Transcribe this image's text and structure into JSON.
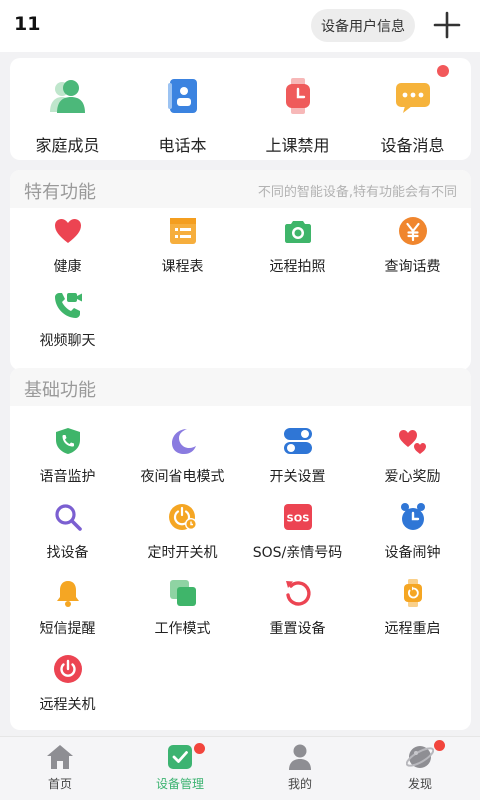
{
  "header": {
    "device_name": "11",
    "user_info_button": "设备用户信息",
    "add_icon": "plus-icon"
  },
  "quick_actions": [
    {
      "label": "家庭成员",
      "icon": "family-members-icon",
      "color": "#4cb87a"
    },
    {
      "label": "电话本",
      "icon": "phonebook-icon",
      "color": "#3b83e0"
    },
    {
      "label": "上课禁用",
      "icon": "class-disable-watch-icon",
      "color": "#ef5b5b"
    },
    {
      "label": "设备消息",
      "icon": "device-message-icon",
      "color": "#f6b33b",
      "has_badge": true
    }
  ],
  "special_section": {
    "title": "特有功能",
    "hint": "不同的智能设备,特有功能会有不同",
    "items": [
      {
        "label": "健康",
        "icon": "heart-icon"
      },
      {
        "label": "课程表",
        "icon": "schedule-icon"
      },
      {
        "label": "远程拍照",
        "icon": "camera-icon"
      },
      {
        "label": "查询话费",
        "icon": "yuan-coin-icon"
      },
      {
        "label": "视频聊天",
        "icon": "video-call-icon"
      }
    ]
  },
  "basic_section": {
    "title": "基础功能",
    "items": [
      {
        "label": "语音监护",
        "icon": "voice-monitor-icon"
      },
      {
        "label": "夜间省电模式",
        "icon": "moon-icon"
      },
      {
        "label": "开关设置",
        "icon": "toggle-icon"
      },
      {
        "label": "爱心奖励",
        "icon": "hearts-icon"
      },
      {
        "label": "找设备",
        "icon": "search-icon"
      },
      {
        "label": "定时开关机",
        "icon": "timed-power-icon"
      },
      {
        "label": "SOS/亲情号码",
        "icon": "sos-icon"
      },
      {
        "label": "设备闹钟",
        "icon": "alarm-clock-icon"
      },
      {
        "label": "短信提醒",
        "icon": "bell-icon"
      },
      {
        "label": "工作模式",
        "icon": "work-mode-icon"
      },
      {
        "label": "重置设备",
        "icon": "reset-icon"
      },
      {
        "label": "远程重启",
        "icon": "remote-restart-icon"
      },
      {
        "label": "远程关机",
        "icon": "power-off-icon"
      }
    ]
  },
  "tabbar": {
    "items": [
      {
        "label": "首页",
        "icon": "home-icon",
        "active": false
      },
      {
        "label": "设备管理",
        "icon": "device-manage-icon",
        "active": true,
        "has_badge": true
      },
      {
        "label": "我的",
        "icon": "profile-icon",
        "active": false
      },
      {
        "label": "发现",
        "icon": "discover-planet-icon",
        "active": false,
        "has_badge": true
      }
    ],
    "active_color": "#3cb371"
  }
}
